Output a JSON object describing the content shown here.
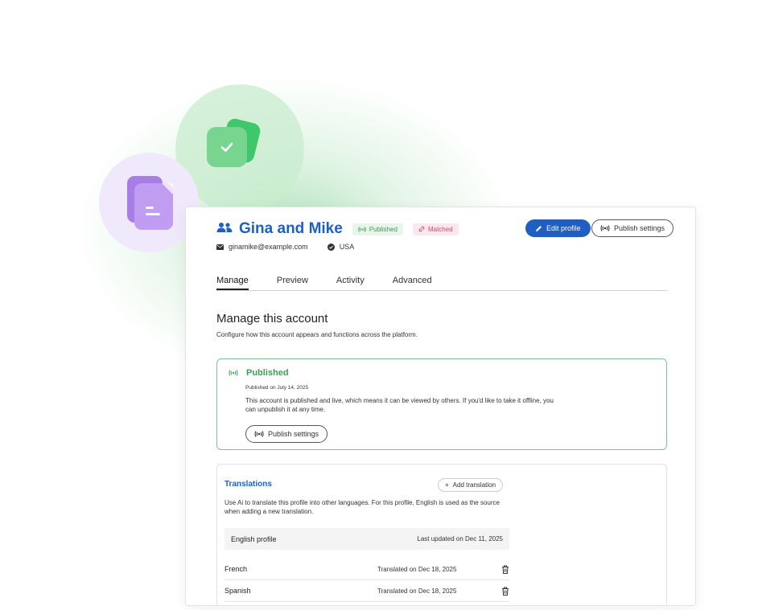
{
  "profile": {
    "name": "Gina and Mike",
    "status_badge": "Published",
    "match_badge": "Matched",
    "email": "ginamike@example.com",
    "country": "USA"
  },
  "header_actions": {
    "edit_label": "Edit profile",
    "publish_settings_label": "Publish settings"
  },
  "tabs": [
    {
      "label": "Manage",
      "active": true
    },
    {
      "label": "Preview",
      "active": false
    },
    {
      "label": "Activity",
      "active": false
    },
    {
      "label": "Advanced",
      "active": false
    }
  ],
  "manage": {
    "title": "Manage this account",
    "description": "Configure how this account appears and functions across the platform."
  },
  "published": {
    "title": "Published",
    "date": "Published on July 14, 2025",
    "description": "This account is published and live, which means it can be viewed by others. If you'd like to take it offline, you can unpublish it at any time.",
    "button_label": "Publish settings"
  },
  "translations": {
    "title": "Translations",
    "add_label": "Add translation",
    "description": "Use Ai to translate this profile into other languages.  For this profile, English is used as the source when adding a new translation.",
    "source": {
      "language": "English profile",
      "updated": "Last updated on Dec 11, 2025"
    },
    "items": [
      {
        "language": "French",
        "translated": "Translated on Dec 18, 2025"
      },
      {
        "language": "Spanish",
        "translated": "Translated on Dec 18, 2025"
      }
    ]
  },
  "colors": {
    "brand_blue": "#1f5fc4",
    "published_green": "#3c9e55",
    "matched_pink": "#d24373",
    "check_green": "#78d590",
    "doc_purple": "#c09df0"
  },
  "icons": [
    "people-icon",
    "broadcast-icon",
    "link-icon",
    "mail-icon",
    "check-circle-icon",
    "pencil-icon",
    "plus-icon",
    "trash-icon",
    "checkmark-icon",
    "document-icon"
  ]
}
